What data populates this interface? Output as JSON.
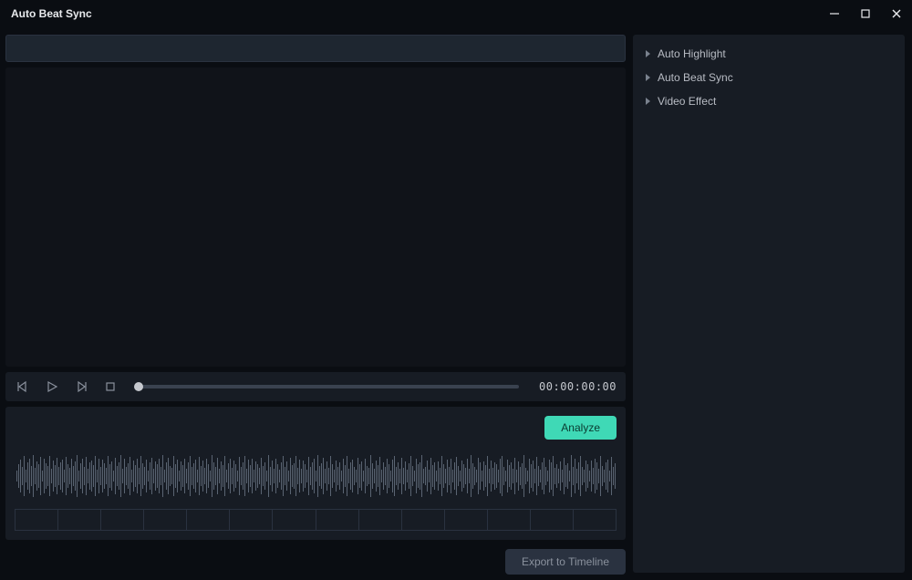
{
  "titlebar": {
    "title": "Auto Beat Sync"
  },
  "playback": {
    "timecode": "00:00:00:00"
  },
  "buttons": {
    "analyze": "Analyze",
    "export": "Export to Timeline"
  },
  "sidebar": {
    "items": [
      {
        "label": "Auto Highlight"
      },
      {
        "label": "Auto Beat Sync"
      },
      {
        "label": "Video Effect"
      }
    ]
  },
  "waveform": {
    "samples": [
      18,
      42,
      55,
      30,
      68,
      22,
      48,
      60,
      35,
      72,
      28,
      50,
      40,
      65,
      20,
      58,
      45,
      33,
      70,
      25,
      52,
      38,
      62,
      30,
      48,
      55,
      22,
      67,
      40,
      28,
      60,
      35,
      50,
      72,
      20,
      44,
      58,
      30,
      65,
      25,
      48,
      52,
      38,
      70,
      22,
      60,
      32,
      55,
      45,
      28,
      68,
      40,
      50,
      20,
      62,
      35,
      48,
      72,
      25,
      58,
      30,
      44,
      66,
      22,
      52,
      38,
      60,
      28,
      70,
      45,
      32,
      55,
      20,
      48,
      64,
      25,
      50,
      40,
      58,
      30,
      72,
      22,
      46,
      62,
      35,
      28,
      68,
      42,
      55,
      20,
      50,
      38,
      60,
      25,
      48,
      70,
      30,
      44,
      56,
      22,
      65,
      35,
      52,
      28,
      58,
      40,
      20,
      72,
      46,
      30,
      62,
      25,
      50,
      36,
      68,
      22,
      44,
      58,
      28,
      52,
      40,
      20,
      66,
      32,
      48,
      70,
      25,
      56,
      38,
      60,
      22,
      50,
      42,
      28,
      64,
      35,
      46,
      20,
      72,
      30,
      54,
      25,
      58,
      40,
      22,
      48,
      68,
      32,
      50,
      20,
      62,
      36,
      44,
      70,
      28,
      56,
      25,
      52,
      40,
      22,
      66,
      30,
      48,
      58,
      20,
      72,
      35,
      44,
      62,
      25,
      50,
      28,
      68,
      40,
      22,
      54,
      32,
      46,
      20,
      60,
      38,
      70,
      25,
      48,
      56,
      30,
      22,
      64,
      42,
      50,
      20,
      58,
      35,
      28,
      72,
      44,
      25,
      52,
      38,
      66,
      22,
      48,
      30,
      60,
      40,
      20,
      56,
      70,
      32,
      46,
      25,
      62,
      28,
      50,
      22,
      44,
      68,
      35,
      20,
      58,
      40,
      48,
      72,
      25,
      30,
      54,
      22,
      64,
      38,
      46,
      20,
      50,
      28,
      70,
      42,
      25,
      56,
      32,
      60,
      22,
      48,
      66,
      35,
      20,
      52,
      40,
      28,
      58,
      25,
      72,
      44,
      30,
      22,
      62,
      48,
      20,
      50,
      36,
      68,
      25,
      54,
      28,
      46,
      40,
      22,
      60,
      70,
      32,
      20,
      56,
      38,
      48,
      25,
      64,
      22,
      50,
      30,
      44,
      72,
      28,
      20,
      58,
      40,
      52,
      25,
      66,
      35,
      22,
      48,
      62,
      30,
      20,
      56,
      46,
      70,
      28,
      40,
      25,
      50,
      22,
      64,
      38,
      44,
      20,
      72,
      32,
      58,
      25,
      48,
      68,
      30,
      22,
      54,
      40,
      20,
      52,
      28,
      60,
      46,
      25,
      70,
      35,
      22,
      48,
      56,
      20,
      66,
      30,
      44,
      40,
      28,
      25,
      62,
      50,
      22,
      72,
      38,
      20,
      54,
      32,
      48,
      68,
      25,
      46,
      28,
      58,
      40,
      22,
      20,
      64,
      50,
      35,
      25,
      70,
      44,
      30,
      22,
      56,
      20,
      48,
      62,
      40,
      28,
      52,
      25,
      66,
      22,
      46,
      38,
      20,
      72,
      30,
      58,
      48,
      25,
      44,
      68,
      35,
      22,
      50,
      28,
      20,
      60,
      40,
      54,
      25,
      64,
      46,
      22,
      72,
      32,
      20,
      48,
      56,
      38,
      28,
      70,
      25,
      50,
      22,
      44,
      62,
      40,
      20,
      58,
      30,
      48,
      66,
      25,
      52,
      22,
      35,
      20,
      72,
      46,
      28,
      60,
      40,
      25,
      54,
      22,
      50,
      68,
      32,
      20,
      44,
      58,
      28,
      25,
      64,
      40,
      48,
      22,
      70,
      36,
      20,
      52,
      30,
      46,
      56,
      25,
      62,
      22,
      28,
      72,
      40,
      20,
      48,
      50,
      35,
      25,
      66,
      44,
      22,
      58,
      30,
      20,
      54,
      68,
      28,
      40,
      25,
      46,
      22,
      60,
      48,
      38,
      20,
      72,
      32,
      50,
      25,
      56,
      28,
      44,
      64,
      22,
      40,
      20,
      70,
      35,
      48,
      25,
      58,
      30,
      22,
      52,
      62,
      20,
      46,
      40,
      28,
      56,
      25,
      68,
      22,
      50,
      35,
      20,
      44,
      72,
      30,
      48,
      60,
      25,
      40,
      22,
      54,
      28,
      66,
      46,
      20,
      50,
      38,
      25,
      62,
      22,
      72,
      32,
      44,
      56,
      20,
      48,
      28,
      40,
      68,
      25,
      52,
      22,
      30,
      58,
      20,
      46,
      64,
      35,
      28,
      40,
      25,
      70,
      48,
      22,
      50,
      20,
      54,
      44,
      62,
      30,
      25,
      72,
      22,
      38,
      56,
      20,
      48,
      40,
      28,
      66,
      25,
      46,
      52,
      22,
      60,
      35,
      20,
      44,
      70,
      30,
      48,
      28,
      25,
      58,
      40,
      22,
      64,
      50,
      20,
      36,
      46,
      72,
      25,
      28,
      54,
      22,
      48,
      62,
      40,
      20,
      56,
      30,
      44,
      68,
      25,
      50,
      22,
      40,
      20,
      58,
      32,
      72,
      28,
      46,
      48,
      25,
      64,
      22,
      52,
      35,
      20,
      44,
      60,
      40,
      28,
      70,
      25,
      48,
      30,
      22,
      56,
      20,
      50,
      66,
      38,
      44,
      25,
      62,
      28,
      22,
      48,
      72,
      40,
      20,
      54,
      35,
      46,
      58,
      25,
      30,
      68,
      22,
      50,
      40,
      20,
      44,
      28,
      64,
      48,
      25,
      56,
      22,
      35,
      72,
      20,
      52,
      40,
      30,
      46,
      60,
      28,
      25,
      70,
      22,
      48,
      44,
      20,
      58,
      40,
      54,
      36,
      25,
      66,
      28,
      22,
      50,
      20,
      62,
      46,
      32,
      48,
      72,
      25,
      40,
      22,
      56,
      28,
      44,
      20,
      68,
      30,
      50,
      35,
      25,
      60,
      22,
      48,
      40,
      20,
      64,
      46,
      28,
      52,
      25,
      72,
      44,
      22,
      30,
      58,
      20,
      48,
      40,
      56,
      35,
      28,
      66,
      25,
      50,
      22,
      46,
      20,
      62,
      40,
      44,
      72,
      30,
      28,
      54
    ],
    "ruler_segments": 14
  }
}
